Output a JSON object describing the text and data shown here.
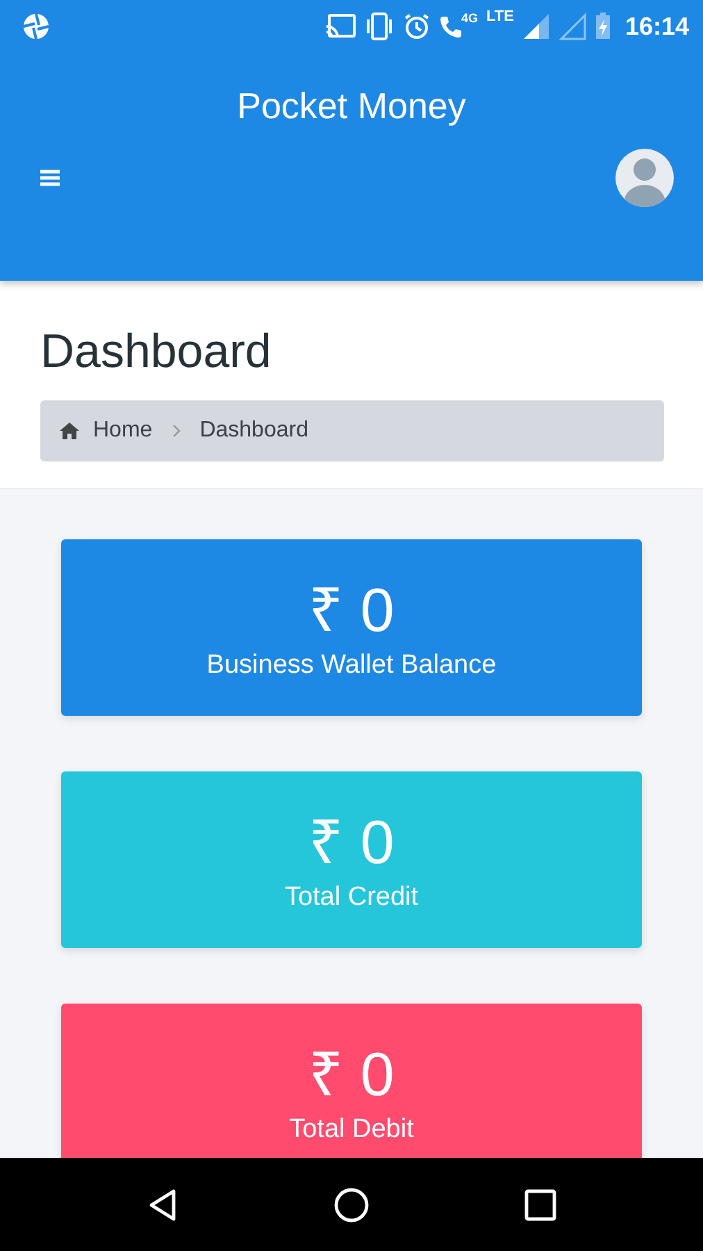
{
  "status_bar": {
    "network_4g": "4G",
    "network_lte": "LTE",
    "time": "16:14"
  },
  "app_bar": {
    "title": "Pocket Money"
  },
  "page": {
    "title": "Dashboard",
    "breadcrumb": [
      {
        "label": "Home",
        "kind": "home"
      },
      {
        "label": "Dashboard",
        "kind": "current"
      }
    ]
  },
  "cards": [
    {
      "amount": "₹ 0",
      "label": "Business Wallet Balance",
      "color": "#1e88e5"
    },
    {
      "amount": "₹ 0",
      "label": "Total Credit",
      "color": "#26c6da"
    },
    {
      "amount": "₹ 0",
      "label": "Total Debit",
      "color": "#ff4b6e"
    }
  ]
}
